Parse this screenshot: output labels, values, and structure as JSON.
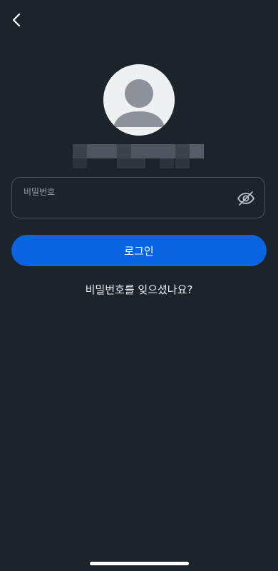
{
  "header": {
    "back_icon": "chevron-left-icon"
  },
  "profile": {
    "avatar_icon": "default-user-avatar-icon",
    "name_masked": true
  },
  "password_field": {
    "label": "비밀번호",
    "value": "",
    "visibility_icon": "eye-off-icon"
  },
  "login_button": {
    "label": "로그인"
  },
  "forgot_password": {
    "label": "비밀번호를 잊으셨나요?"
  },
  "colors": {
    "background": "#1b232b",
    "primary": "#0a64e0",
    "field_border": "#4a545d",
    "label_text": "#9aa3ab"
  }
}
